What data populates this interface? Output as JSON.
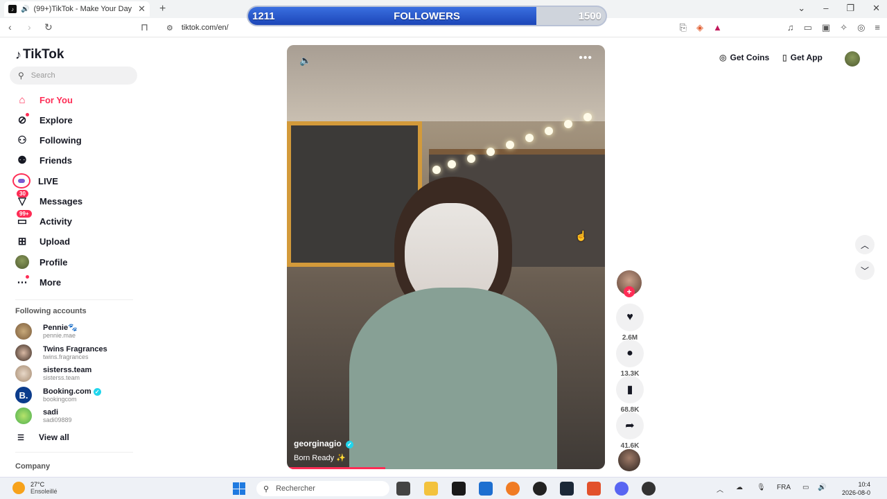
{
  "browser": {
    "tab_title": "(99+)TikTok - Make Your Day",
    "new_tab": "+",
    "url": "tiktok.com/en/"
  },
  "followers_bar": {
    "current": "1211",
    "label": "FOLLOWERS",
    "goal": "1500",
    "progress": 0.807
  },
  "sidebar": {
    "logo": "TikTok",
    "search_placeholder": "Search",
    "nav": [
      {
        "label": "For You",
        "icon": "home-icon"
      },
      {
        "label": "Explore",
        "icon": "compass-icon"
      },
      {
        "label": "Following",
        "icon": "following-icon"
      },
      {
        "label": "Friends",
        "icon": "friends-icon"
      },
      {
        "label": "LIVE",
        "icon": "live-icon"
      },
      {
        "label": "Messages",
        "icon": "messages-icon",
        "badge": "30"
      },
      {
        "label": "Activity",
        "icon": "activity-icon",
        "badge": "99+"
      },
      {
        "label": "Upload",
        "icon": "upload-icon"
      },
      {
        "label": "Profile",
        "icon": "profile-avatar"
      },
      {
        "label": "More",
        "icon": "more-icon"
      }
    ],
    "following_title": "Following accounts",
    "accounts": [
      {
        "name": "Pennie🐾",
        "handle": "pennie.mae"
      },
      {
        "name": "Twins Fragrances",
        "handle": "twins.fragrances"
      },
      {
        "name": "sisterss.team",
        "handle": "sisterss.team"
      },
      {
        "name": "Booking.com",
        "handle": "bookingcom",
        "verified": true
      },
      {
        "name": "sadi",
        "handle": "sadi09889"
      }
    ],
    "view_all": "View all",
    "company": "Company"
  },
  "video": {
    "username": "georginagio",
    "caption": "Born Ready ✨",
    "progress": 0.31
  },
  "actions": {
    "likes": "2.6M",
    "comments": "13.3K",
    "saves": "68.8K",
    "shares": "41.6K"
  },
  "topright": {
    "get_coins": "Get Coins",
    "get_app": "Get App"
  },
  "taskbar": {
    "temp": "27°C",
    "weather": "Ensoleillé",
    "search": "Rechercher",
    "lang": "FRA",
    "time": "10:4",
    "date": "2026-08-0"
  },
  "colors": {
    "accent": "#fe2c55",
    "followers_fill": "#2a5bd7"
  }
}
